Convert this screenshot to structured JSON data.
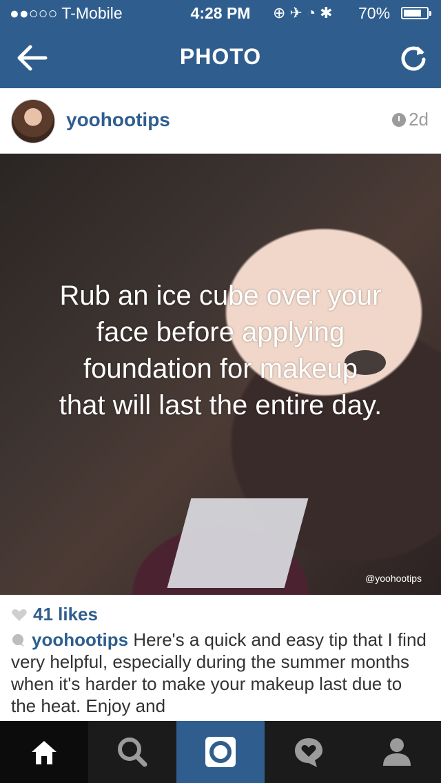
{
  "status_bar": {
    "carrier": "●●○○○ T-Mobile",
    "time": "4:28 PM",
    "battery_pct": "70%"
  },
  "nav": {
    "title": "PHOTO",
    "back_icon": "arrow-left-icon",
    "refresh_icon": "refresh-icon"
  },
  "post": {
    "username": "yoohootips",
    "time_ago": "2d",
    "photo": {
      "overlay_lines": [
        "Rub an ice cube over your",
        "face before applying",
        "foundation for makeup",
        "that will last the entire day."
      ],
      "handle": "@yoohootips"
    },
    "likes": "41 likes",
    "caption": {
      "user": "yoohootips",
      "text": "Here's a quick and easy tip that I find very helpful, especially during the summer months when it's harder to make your makeup last due to the heat. Enjoy and"
    }
  },
  "tabbar": {
    "tabs": [
      "home-icon",
      "search-icon",
      "camera-icon",
      "activity-icon",
      "profile-icon"
    ],
    "active": "home-icon"
  },
  "colors": {
    "brand": "#2f5e8e",
    "tabbar": "#1b1b1b"
  }
}
